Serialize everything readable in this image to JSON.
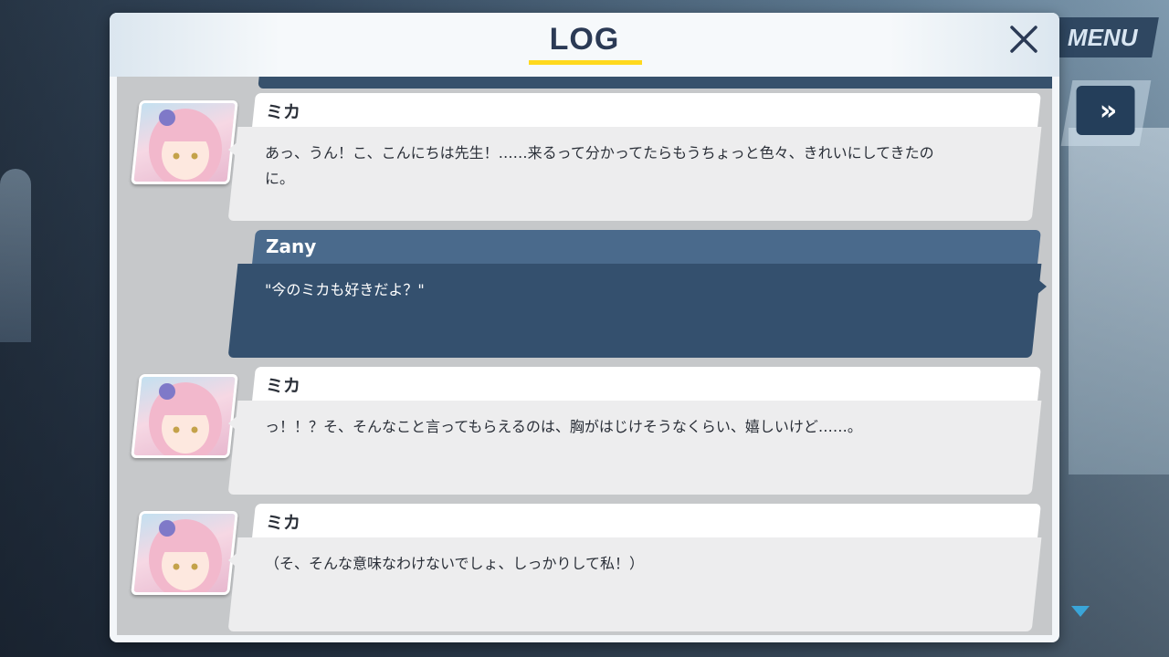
{
  "header": {
    "title": "LOG",
    "close_icon": "close-icon"
  },
  "menu": {
    "label": "MENU",
    "skip_label": "»"
  },
  "colors": {
    "accent_underline": "#ffd91e",
    "player_bubble": "#34506e",
    "npc_bubble": "#ededee"
  },
  "entries": [
    {
      "speaker": "ミカ",
      "text": "あっ、うん！こ、こんにちは先生！……来るって分かってたらもうちょっと色々、きれいにしてきたのに。",
      "type": "npc"
    },
    {
      "speaker": "Zany",
      "text": "\"今のミカも好きだよ？\"",
      "type": "player"
    },
    {
      "speaker": "ミカ",
      "text": "っ！！？そ、そんなこと言ってもらえるのは、胸がはじけそうなくらい、嬉しいけど……。",
      "type": "npc"
    },
    {
      "speaker": "ミカ",
      "text": "（そ、そんな意味なわけないでしょ、しっかりして私！）",
      "type": "npc"
    }
  ]
}
